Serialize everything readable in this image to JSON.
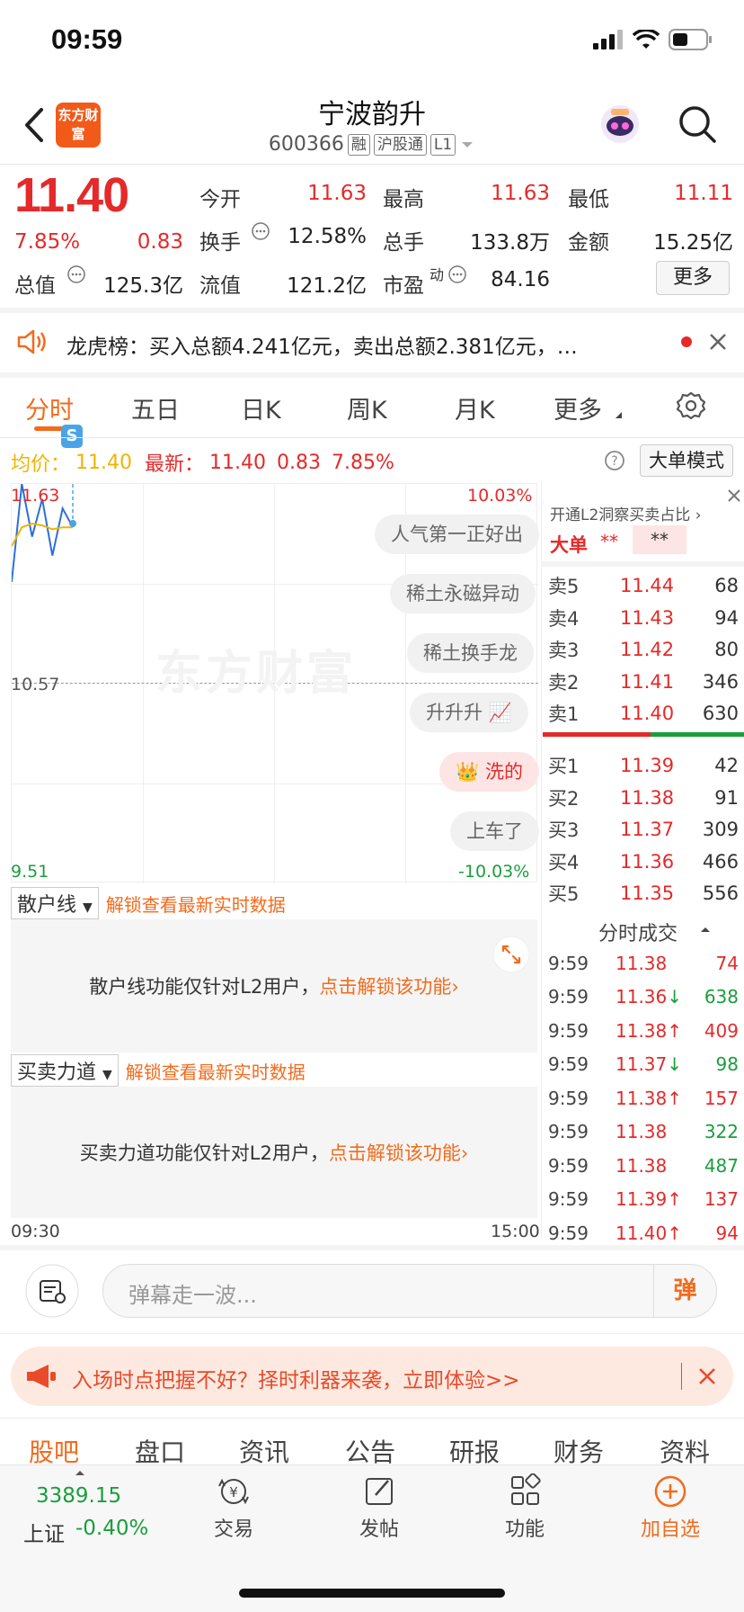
{
  "status": {
    "time": "09:59"
  },
  "header": {
    "title": "宁波韵升",
    "code": "600366",
    "tags": [
      "融",
      "沪股通",
      "L1"
    ],
    "logo": "东方财富"
  },
  "quote": {
    "price": "11.40",
    "change_pct": "7.85%",
    "change": "0.83",
    "open_label": "今开",
    "open": "11.63",
    "high_label": "最高",
    "high": "11.63",
    "low_label": "最低",
    "low": "11.11",
    "turnover_label": "换手",
    "turnover": "12.58%",
    "volume_label": "总手",
    "volume": "133.8万",
    "amount_label": "金额",
    "amount": "15.25亿",
    "mktcap_label": "总值",
    "mktcap": "125.3亿",
    "float_label": "流值",
    "float": "121.2亿",
    "pe_label": "市盈",
    "pe_sup": "动",
    "pe": "84.16",
    "more_label": "更多"
  },
  "notice": {
    "text": "龙虎榜：买入总额4.241亿元，卖出总额2.381亿元，…"
  },
  "tabs": [
    "分时",
    "五日",
    "日K",
    "周K",
    "月K",
    "更多"
  ],
  "chart_info": {
    "avg_label": "均价：",
    "avg": "11.40",
    "latest_label": "最新：",
    "latest": "11.40",
    "latest_change": "0.83",
    "latest_pct": "7.85%",
    "mode_button": "大单模式",
    "y_top": "11.63",
    "y_mid": "10.57",
    "y_bottom": "9.51",
    "pct_top": "10.03%",
    "pct_bottom": "-10.03%",
    "x_start": "09:30",
    "x_end": "15:00",
    "watermark": "东方财富",
    "bubble_s": "S"
  },
  "chart_data": {
    "type": "line",
    "x": [
      "09:30",
      "09:35",
      "09:40",
      "09:45",
      "09:50",
      "09:55",
      "09:59"
    ],
    "series": [
      {
        "name": "最新",
        "values": [
          11.11,
          11.63,
          11.35,
          11.55,
          11.25,
          11.5,
          11.4
        ]
      },
      {
        "name": "均价",
        "values": [
          11.3,
          11.4,
          11.42,
          11.41,
          11.39,
          11.4,
          11.4
        ]
      }
    ],
    "ylim": [
      9.51,
      11.63
    ]
  },
  "danmu": [
    "人气第一正好出",
    "稀土永磁异动",
    "稀土换手龙",
    "升升升",
    "洗的",
    "上车了"
  ],
  "orderbook": {
    "header": "开通L2洞察买卖占比 ›",
    "big_order_label": "大单",
    "big_val1": "**",
    "big_val2": "**",
    "asks": [
      {
        "label": "卖5",
        "price": "11.44",
        "vol": "68"
      },
      {
        "label": "卖4",
        "price": "11.43",
        "vol": "94"
      },
      {
        "label": "卖3",
        "price": "11.42",
        "vol": "80"
      },
      {
        "label": "卖2",
        "price": "11.41",
        "vol": "346"
      },
      {
        "label": "卖1",
        "price": "11.40",
        "vol": "630"
      }
    ],
    "bids": [
      {
        "label": "买1",
        "price": "11.39",
        "vol": "42"
      },
      {
        "label": "买2",
        "price": "11.38",
        "vol": "91"
      },
      {
        "label": "买3",
        "price": "11.37",
        "vol": "309"
      },
      {
        "label": "买4",
        "price": "11.36",
        "vol": "466"
      },
      {
        "label": "买5",
        "price": "11.35",
        "vol": "556"
      }
    ],
    "trades_title": "分时成交",
    "trades": [
      {
        "time": "9:59",
        "price": "11.38",
        "vol": "74",
        "dir": ""
      },
      {
        "time": "9:59",
        "price": "11.36↓",
        "vol": "638",
        "dir": "down"
      },
      {
        "time": "9:59",
        "price": "11.38↑",
        "vol": "409",
        "dir": "up"
      },
      {
        "time": "9:59",
        "price": "11.37↓",
        "vol": "98",
        "dir": "down"
      },
      {
        "time": "9:59",
        "price": "11.38↑",
        "vol": "157",
        "dir": "up"
      },
      {
        "time": "9:59",
        "price": "11.38",
        "vol": "322",
        "dir": "down"
      },
      {
        "time": "9:59",
        "price": "11.38",
        "vol": "487",
        "dir": "down"
      },
      {
        "time": "9:59",
        "price": "11.39↑",
        "vol": "137",
        "dir": "up"
      },
      {
        "time": "9:59",
        "price": "11.40↑",
        "vol": "94",
        "dir": "up"
      }
    ]
  },
  "panels": {
    "retail": {
      "tab": "散户线",
      "link": "解锁查看最新实时数据",
      "msg": "散户线功能仅针对L2用户，",
      "action": "点击解锁该功能›"
    },
    "force": {
      "tab": "买卖力道",
      "link": "解锁查看最新实时数据",
      "msg": "买卖力道功能仅针对L2用户，",
      "action": "点击解锁该功能›"
    }
  },
  "comment": {
    "placeholder": "弹幕走一波...",
    "danmu_btn": "弹"
  },
  "promo": {
    "text": "入场时点把握不好？择时利器来袭，立即体验>>"
  },
  "bottom_tabs": [
    "股吧",
    "盘口",
    "资讯",
    "公告",
    "研报",
    "财务",
    "资料"
  ],
  "nav": {
    "index_value": "3389.15",
    "index_name": "上证",
    "index_change": "-0.40%",
    "items": [
      "交易",
      "发帖",
      "功能",
      "加自选"
    ]
  }
}
